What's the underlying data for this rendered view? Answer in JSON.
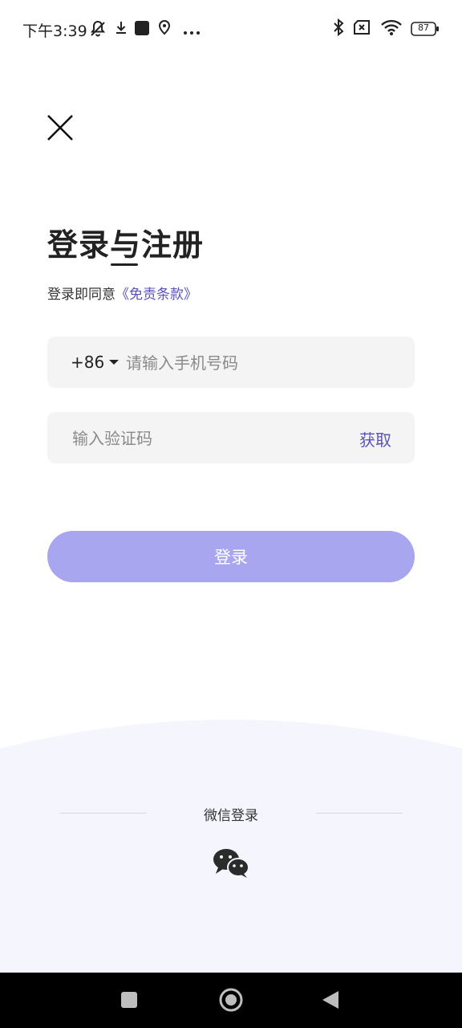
{
  "status_bar": {
    "time": "下午3:39",
    "battery": "87"
  },
  "page": {
    "title": "登录与注册",
    "agreement_prefix": "登录即同意",
    "agreement_link": "《免责条款》"
  },
  "form": {
    "country_code": "+86",
    "phone_placeholder": "请输入手机号码",
    "code_placeholder": "输入验证码",
    "get_code_label": "获取",
    "login_label": "登录"
  },
  "social": {
    "wechat_label": "微信登录"
  },
  "colors": {
    "accent": "#5a54b8",
    "button": "#a9a6f0",
    "field_bg": "#f4f4f4",
    "bottom_bg": "#f5f6fd"
  }
}
